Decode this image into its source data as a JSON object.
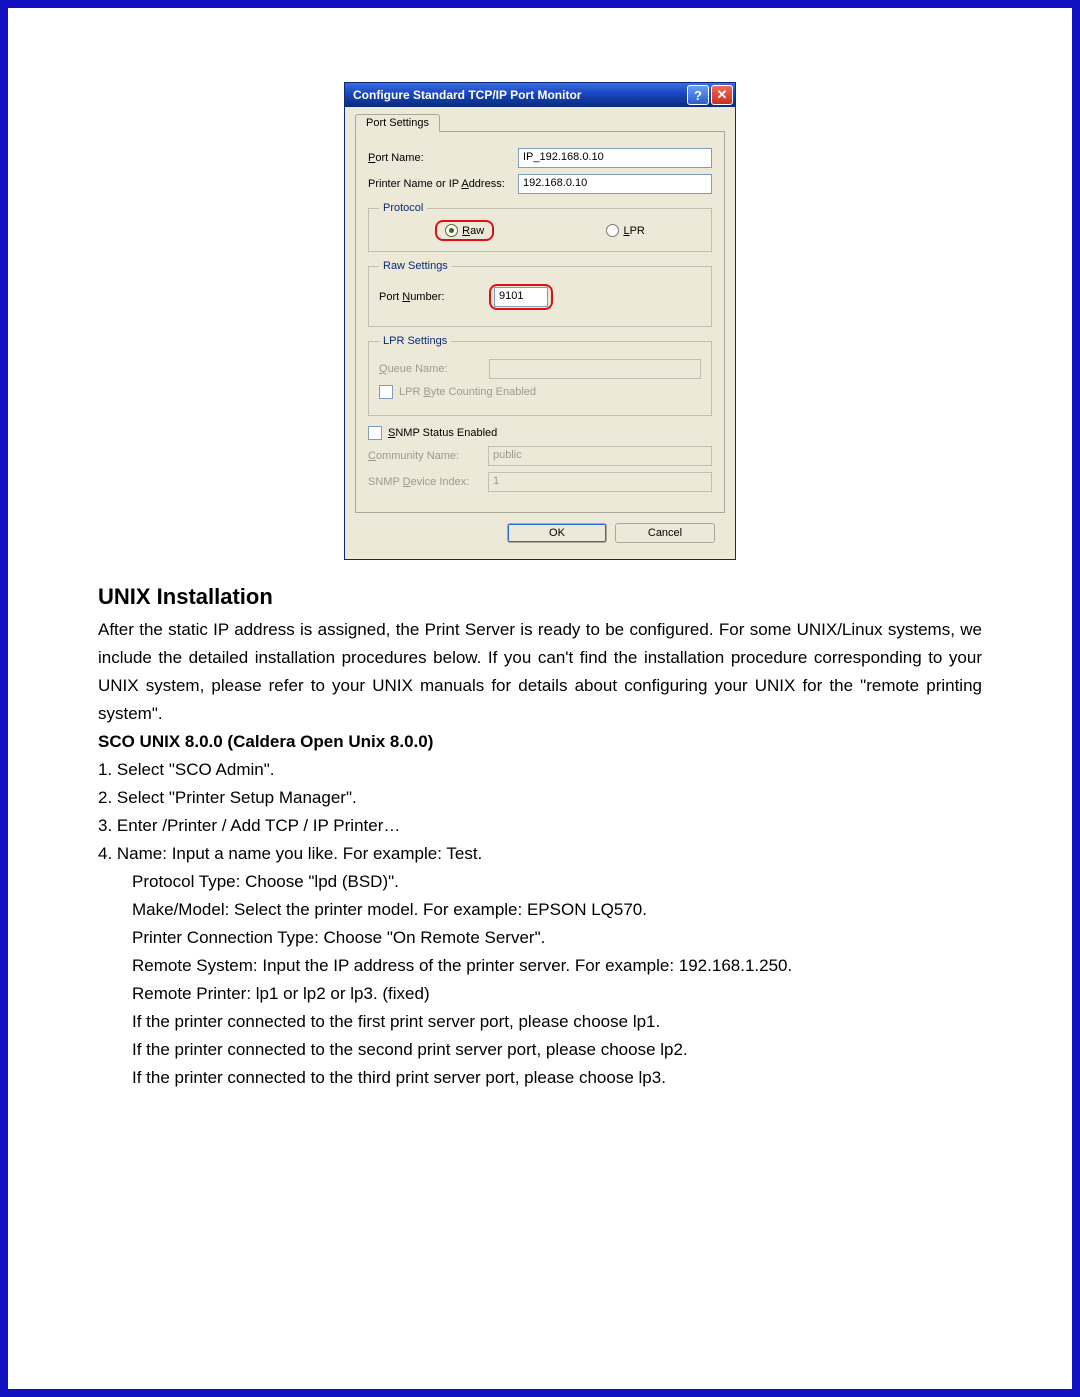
{
  "dialog": {
    "title": "Configure Standard TCP/IP Port Monitor",
    "tab_label": "Port Settings",
    "port_name_label": "Port Name:",
    "port_name_value": "IP_192.168.0.10",
    "printer_addr_label": "Printer Name or IP Address:",
    "printer_addr_value": "192.168.0.10",
    "protocol": {
      "legend": "Protocol",
      "raw": "Raw",
      "lpr": "LPR"
    },
    "raw_settings": {
      "legend": "Raw Settings",
      "port_number_label": "Port Number:",
      "port_number_value": "9101"
    },
    "lpr_settings": {
      "legend": "LPR Settings",
      "queue_label": "Queue Name:",
      "byte_counting": "LPR Byte Counting Enabled"
    },
    "snmp": {
      "status": "SNMP Status Enabled",
      "community_label": "Community Name:",
      "community_value": "public",
      "index_label": "SNMP Device Index:",
      "index_value": "1"
    },
    "ok": "OK",
    "cancel": "Cancel",
    "help_glyph": "?",
    "close_glyph": "✕"
  },
  "doc": {
    "heading": "UNIX Installation",
    "intro": "After the static IP address is assigned, the Print Server is ready to be configured. For some UNIX/Linux systems, we include the detailed installation procedures below. If you can't find the installation procedure corresponding to your UNIX system, please refer to your UNIX manuals for details about configuring your UNIX for the \"remote printing system\".",
    "sub": "SCO UNIX 8.0.0 (Caldera Open Unix 8.0.0)",
    "steps": {
      "s1": "1. Select \"SCO Admin\".",
      "s2": "2. Select \"Printer Setup Manager\".",
      "s3": "3. Enter /Printer / Add TCP / IP Printer…",
      "s4": "4. Name: Input a name you like. For example: Test.",
      "s4a": "Protocol Type: Choose \"lpd (BSD)\".",
      "s4b": "Make/Model: Select the printer model. For example: EPSON LQ570.",
      "s4c": "Printer Connection Type: Choose \"On Remote Server\".",
      "s4d": "Remote System: Input the IP address of the printer server. For example: 192.168.1.250.",
      "s4e": "Remote Printer: lp1 or lp2 or lp3. (fixed)",
      "s4f": "If the printer connected to the first print server port, please choose lp1.",
      "s4g": "If the printer connected to the second print server port, please choose lp2.",
      "s4h": "If the printer connected to the third print server port, please choose lp3."
    }
  }
}
